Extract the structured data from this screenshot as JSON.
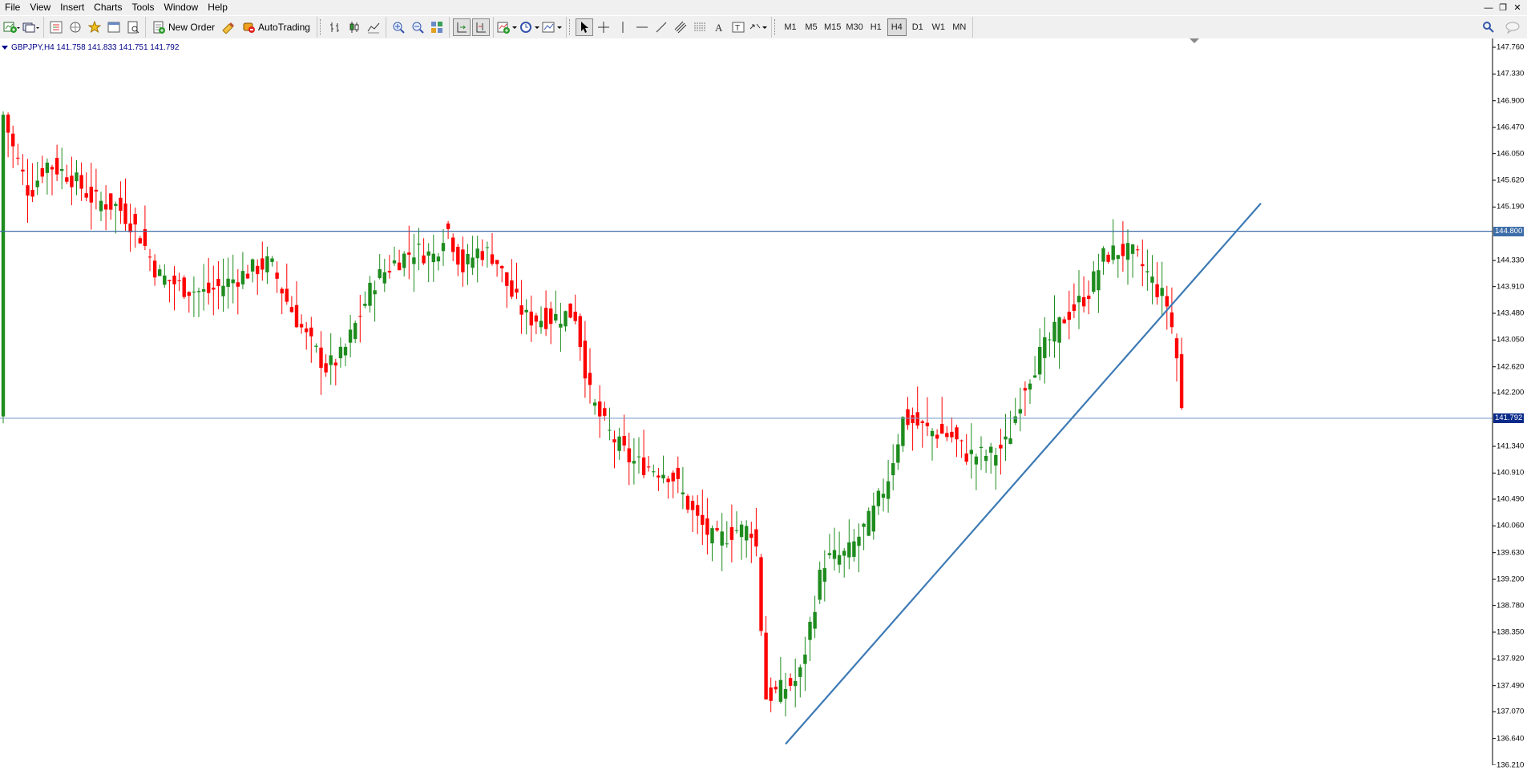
{
  "menu": [
    {
      "label": "File",
      "accel": "F"
    },
    {
      "label": "View",
      "accel": "V"
    },
    {
      "label": "Insert",
      "accel": "I"
    },
    {
      "label": "Charts",
      "accel": "C"
    },
    {
      "label": "Tools",
      "accel": "T"
    },
    {
      "label": "Window",
      "accel": "W"
    },
    {
      "label": "Help",
      "accel": "H"
    }
  ],
  "toolbar": {
    "new_order_label": "New Order",
    "autotrading_label": "AutoTrading",
    "timeframes": [
      "M1",
      "M5",
      "M15",
      "M30",
      "H1",
      "H4",
      "D1",
      "W1",
      "MN"
    ],
    "active_timeframe": "H4"
  },
  "chart": {
    "symbol_line": "GBPJPY,H4  141.758 141.833 141.751 141.792",
    "price_axis": [
      "147.760",
      "147.330",
      "146.900",
      "146.470",
      "146.050",
      "145.620",
      "145.190",
      "144.800",
      "144.330",
      "143.910",
      "143.480",
      "143.050",
      "142.620",
      "142.200",
      "141.792",
      "141.340",
      "140.910",
      "140.490",
      "140.060",
      "139.630",
      "139.200",
      "138.780",
      "138.350",
      "137.920",
      "137.490",
      "137.070",
      "136.640",
      "136.210"
    ],
    "horizontal_level_tag": "144.800",
    "current_price_tag": "141.792",
    "colors": {
      "bull": "#1e8c1e",
      "bear": "#ff0000",
      "line": "#3d7ab5",
      "hline": "#3d6da8",
      "tag_bg": "#0a2a8a"
    }
  },
  "chart_data": {
    "type": "candlestick",
    "symbol": "GBPJPY",
    "timeframe": "H4",
    "ylim": [
      136.21,
      147.76
    ],
    "horizontal_lines": [
      144.8,
      141.792
    ],
    "trendline": [
      {
        "bar": 0,
        "price": 136.55
      },
      {
        "bar": 1,
        "price": 145.25
      }
    ],
    "ohlc_summary": {
      "open": 141.758,
      "high": 141.833,
      "low": 141.751,
      "close": 141.792
    }
  }
}
